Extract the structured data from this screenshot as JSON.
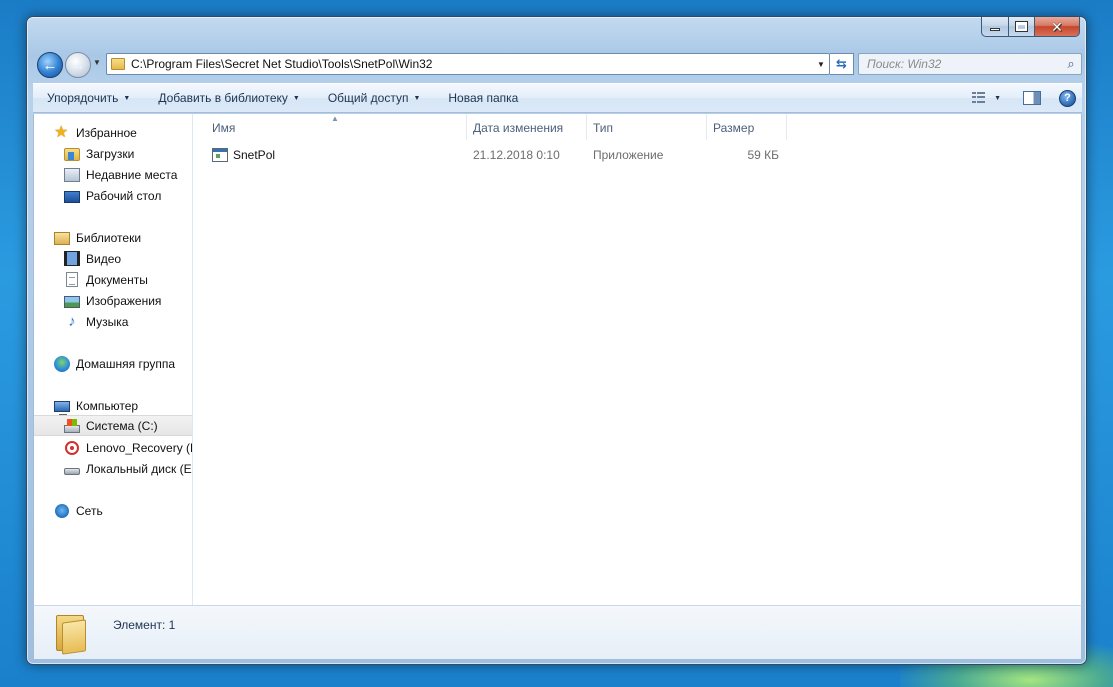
{
  "window": {
    "caption_buttons": {
      "minimize": "minimize-icon",
      "maximize": "maximize-icon",
      "close": "close-icon"
    }
  },
  "address_bar": {
    "path": "C:\\Program Files\\Secret Net Studio\\Tools\\SnetPol\\Win32"
  },
  "search": {
    "placeholder": "Поиск: Win32"
  },
  "toolbar": {
    "organize": "Упорядочить",
    "add_to_library": "Добавить в библиотеку",
    "share": "Общий доступ",
    "new_folder": "Новая папка"
  },
  "sidebar": {
    "favorites": {
      "label": "Избранное",
      "items": [
        {
          "label": "Загрузки",
          "icon": "downloads-folder-icon"
        },
        {
          "label": "Недавние места",
          "icon": "recent-places-icon"
        },
        {
          "label": "Рабочий стол",
          "icon": "desktop-icon"
        }
      ]
    },
    "libraries": {
      "label": "Библиотеки",
      "items": [
        {
          "label": "Видео",
          "icon": "video-library-icon"
        },
        {
          "label": "Документы",
          "icon": "documents-library-icon"
        },
        {
          "label": "Изображения",
          "icon": "pictures-library-icon"
        },
        {
          "label": "Музыка",
          "icon": "music-library-icon"
        }
      ]
    },
    "homegroup": {
      "label": "Домашняя группа"
    },
    "computer": {
      "label": "Компьютер",
      "items": [
        {
          "label": "Система (C:)",
          "icon": "system-drive-icon",
          "selected": true
        },
        {
          "label": "Lenovo_Recovery (D",
          "icon": "recovery-drive-icon"
        },
        {
          "label": "Локальный диск (E:",
          "icon": "local-drive-icon"
        }
      ]
    },
    "network": {
      "label": "Сеть"
    }
  },
  "file_list": {
    "columns": [
      "Имя",
      "Дата изменения",
      "Тип",
      "Размер"
    ],
    "rows": [
      {
        "name": "SnetPol",
        "modified": "21.12.2018 0:10",
        "type": "Приложение",
        "size": "59 КБ"
      }
    ]
  },
  "details": {
    "text": "Элемент: 1"
  }
}
